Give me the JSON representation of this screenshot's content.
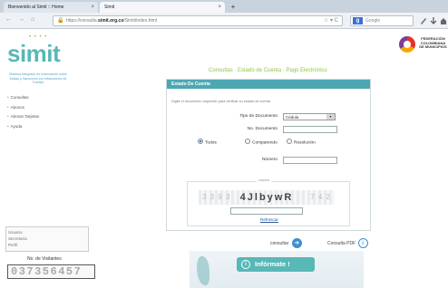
{
  "browser": {
    "tabs": [
      {
        "label": "Bienvenido al Simit :: Home",
        "close": "×"
      },
      {
        "label": "Simit",
        "close": "×"
      }
    ],
    "new_tab": "+",
    "nav": {
      "back": "←",
      "forward": "→",
      "home": "⌂",
      "refresh": "↻"
    },
    "url_prefix": "https://consulta.",
    "url_domain": "simit.org.co",
    "url_path": "/Simit/index.html",
    "url_tail": "☆ ▾ C",
    "search_engine": "g",
    "search_placeholder": "Google",
    "toolbar_icons": [
      "pencil-icon",
      "download-icon",
      "home-icon"
    ]
  },
  "sidebar": {
    "logo": "simit",
    "logo_dots": "• • • •",
    "tagline": "Sistema Integrado de Información sobre Multas y Sanciones por Infracciones de Tránsito",
    "menu": [
      {
        "label": "Consultas"
      },
      {
        "label": "Abonos"
      },
      {
        "label": "Abonar Tarjetas"
      },
      {
        "label": "Ayuda"
      }
    ],
    "user_box": [
      "Usuario",
      "Secretaría",
      "Perfil"
    ],
    "visit_label": "No. de Visitantes",
    "visit_count": "037356457"
  },
  "header": {
    "breadcrumb": "Consultas · Estado de Cuenta · Pago Electrónico",
    "federation": "FEDERACIÓN COLOMBIANA DE MUNICIPIOS"
  },
  "form": {
    "title": "Estado De Cuenta",
    "hint": "Digite el documento requerido para verificar su estado de cuenta",
    "doc_type_label": "Tipo de Documento",
    "doc_type_value": "Cédula",
    "doc_number_label": "No. Documento",
    "radios": [
      {
        "label": "Todos",
        "checked": true
      },
      {
        "label": "Comparendo",
        "checked": false
      },
      {
        "label": "Resolución",
        "checked": false
      }
    ],
    "number_label": "Número",
    "captcha_legend": "captcha",
    "captcha_text": "4JlbywR",
    "captcha_noise_left": "3 3 9 3",
    "captcha_noise_right": "7 4 2",
    "refresh_label": "Refrescar"
  },
  "actions": {
    "consultar": "consultar",
    "consulta_pdf": "Consulta PDF"
  },
  "banner": {
    "label": "Infórmate !"
  }
}
